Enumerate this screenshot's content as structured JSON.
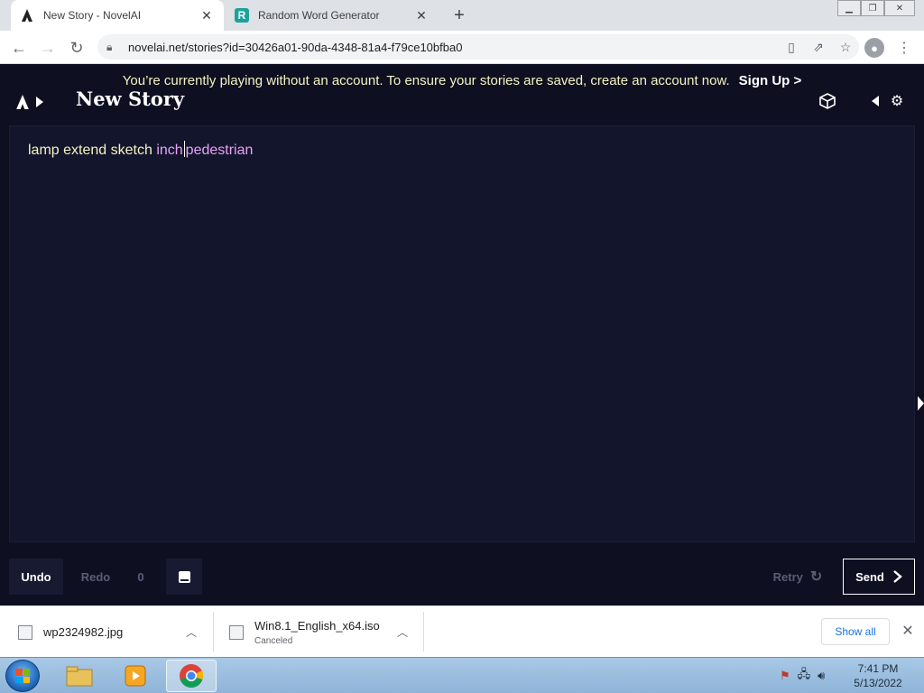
{
  "browser": {
    "tabs": [
      {
        "title": "New Story - NovelAI",
        "active": true,
        "favicon": "novelai-logo-icon"
      },
      {
        "title": "Random Word Generator",
        "active": false,
        "favicon": "R"
      }
    ],
    "url": "novelai.net/stories?id=30426a01-90da-4348-81a4-f79ce10bfba0"
  },
  "app": {
    "banner_text": "You’re currently playing without an account. To ensure your stories are saved, create an account now.",
    "banner_link": "Sign Up >",
    "story_title": "New Story",
    "editor": {
      "text_plain": "lamp extend sketch",
      "text_generated_1": "inch",
      "text_generated_2": "pedestrian"
    },
    "controls": {
      "undo": "Undo",
      "redo": "Redo",
      "redo_count": "0",
      "retry": "Retry",
      "send": "Send"
    },
    "colors": {
      "background": "#0e0f21",
      "editor_bg": "#13152c",
      "user_text": "#f5f3c2",
      "ai_text": "#e7a3f6"
    }
  },
  "downloads": {
    "items": [
      {
        "name": "wp2324982.jpg",
        "status": ""
      },
      {
        "name": "Win8.1_English_x64.iso",
        "status": "Canceled"
      }
    ],
    "show_all": "Show all"
  },
  "taskbar": {
    "time": "7:41 PM",
    "date": "5/13/2022"
  }
}
